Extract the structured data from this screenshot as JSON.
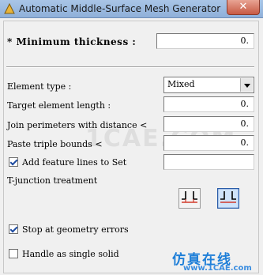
{
  "window": {
    "title": "Automatic Middle-Surface Mesh Generator",
    "close_label": "✕"
  },
  "minimum_thickness": {
    "label": "* Minimum  thickness :",
    "value": "0."
  },
  "element_type": {
    "label": "Element type :",
    "selected": "Mixed"
  },
  "target_element_length": {
    "label": "Target element length :",
    "value": "0."
  },
  "join_perimeters": {
    "label": "Join perimeters with distance <",
    "value": "0."
  },
  "paste_triple_bounds": {
    "label": "Paste triple bounds <",
    "value": "0."
  },
  "add_feature_lines": {
    "label": "Add feature lines to Set",
    "checked": true,
    "value": ""
  },
  "t_junction": {
    "label": "T-junction treatment",
    "options": [
      "t-junction-split-icon",
      "t-junction-merge-icon"
    ],
    "selected_index": 1
  },
  "stop_at_geometry_errors": {
    "label": "Stop at geometry errors",
    "checked": true
  },
  "handle_as_single_solid": {
    "label": "Handle as single solid",
    "checked": false
  },
  "watermark": {
    "site": "1CAE.COM",
    "cn": "仿真在线",
    "url": "www.1CAE.com"
  }
}
